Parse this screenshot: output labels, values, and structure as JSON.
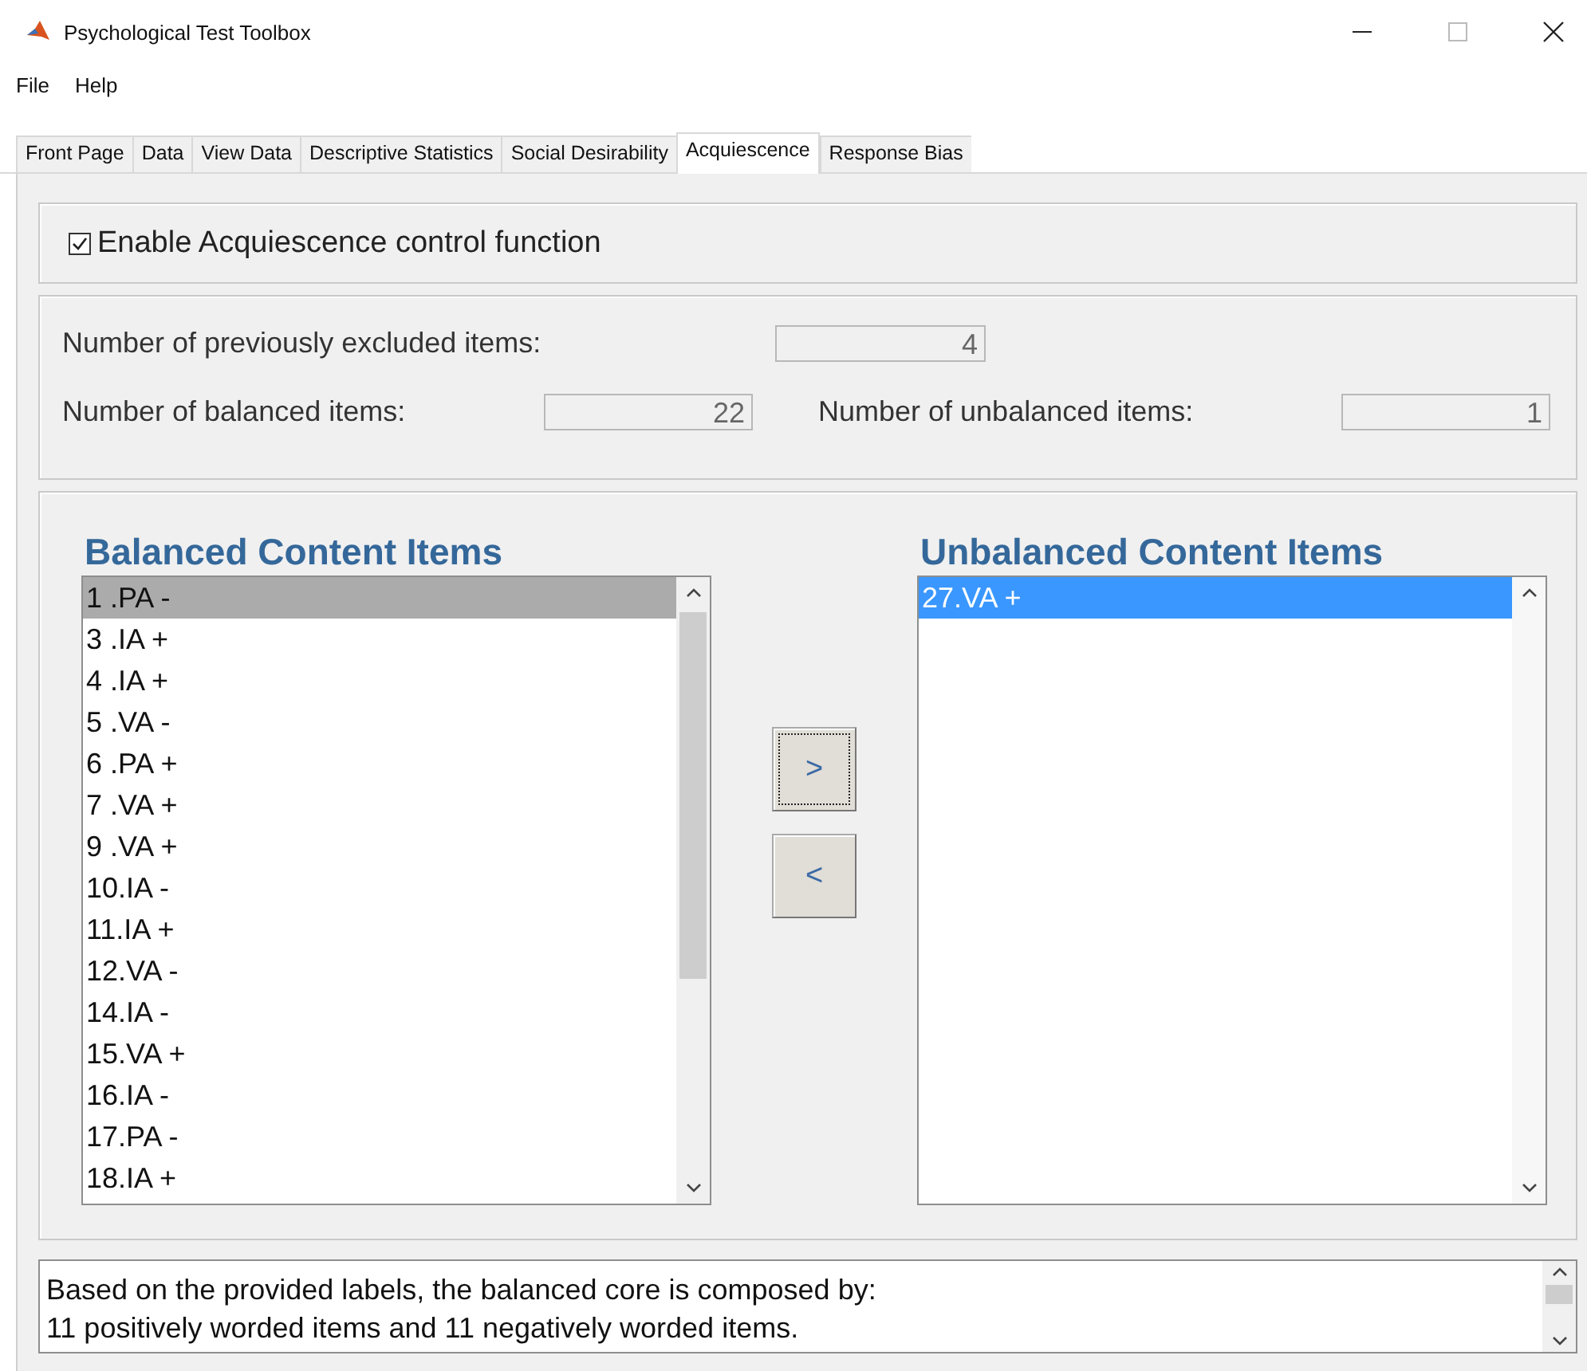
{
  "window": {
    "title": "Psychological Test Toolbox"
  },
  "menu": [
    "File",
    "Help"
  ],
  "tabs": [
    {
      "label": "Front Page",
      "selected": false
    },
    {
      "label": "Data",
      "selected": false
    },
    {
      "label": "View Data",
      "selected": false
    },
    {
      "label": "Descriptive Statistics",
      "selected": false
    },
    {
      "label": "Social Desirability",
      "selected": false
    },
    {
      "label": "Acquiescence",
      "selected": true
    },
    {
      "label": "Response Bias",
      "selected": false
    }
  ],
  "enable_checkbox": {
    "label": "Enable Acquiescence control function",
    "checked": true
  },
  "counts": [
    {
      "label": "Number of previously excluded items:",
      "value": "4"
    },
    {
      "label": "Number of balanced items:",
      "value": "22"
    },
    {
      "label": "Number of unbalanced items:",
      "value": "1"
    }
  ],
  "balanced_list": {
    "title": "Balanced Content Items",
    "focused": false,
    "items": [
      {
        "text": "1 .PA -",
        "selected": true
      },
      {
        "text": "3 .IA +",
        "selected": false
      },
      {
        "text": "4 .IA +",
        "selected": false
      },
      {
        "text": "5 .VA -",
        "selected": false
      },
      {
        "text": "6 .PA +",
        "selected": false
      },
      {
        "text": "7 .VA +",
        "selected": false
      },
      {
        "text": "9 .VA +",
        "selected": false
      },
      {
        "text": "10.IA -",
        "selected": false
      },
      {
        "text": "11.IA +",
        "selected": false
      },
      {
        "text": "12.VA -",
        "selected": false
      },
      {
        "text": "14.IA -",
        "selected": false
      },
      {
        "text": "15.VA +",
        "selected": false
      },
      {
        "text": "16.IA -",
        "selected": false
      },
      {
        "text": "17.PA -",
        "selected": false
      },
      {
        "text": "18.IA +",
        "selected": false
      }
    ]
  },
  "move_buttons": [
    {
      "label": ">",
      "focused": true
    },
    {
      "label": "<",
      "focused": false
    }
  ],
  "unbalanced_list": {
    "title": "Unbalanced Content Items",
    "focused": true,
    "items": [
      {
        "text": "27.VA +",
        "selected": true
      }
    ]
  },
  "summary": [
    "Based on the provided labels, the balanced core is composed by:",
    "11 positively worded items and 11 negatively worded items."
  ]
}
